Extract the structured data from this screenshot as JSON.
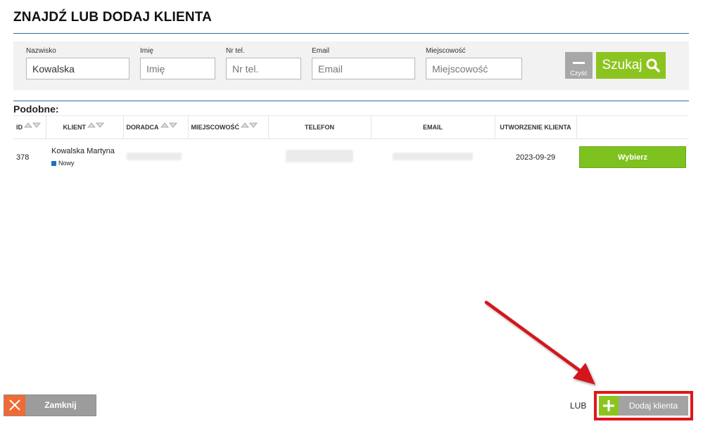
{
  "page": {
    "title": "ZNAJDŹ LUB DODAJ KLIENTA",
    "similar_heading": "Podobne:"
  },
  "search": {
    "fields": [
      {
        "label": "Nazwisko",
        "value": "Kowalska",
        "placeholder": "Nazwisko"
      },
      {
        "label": "Imię",
        "value": "",
        "placeholder": "Imię"
      },
      {
        "label": "Nr tel.",
        "value": "",
        "placeholder": "Nr tel."
      },
      {
        "label": "Email",
        "value": "",
        "placeholder": "Email"
      },
      {
        "label": "Miejscowość",
        "value": "",
        "placeholder": "Miejscowość"
      }
    ],
    "clear_label": "Czyść",
    "search_label": "Szukaj"
  },
  "table": {
    "columns": [
      {
        "label": "ID",
        "sortable": true
      },
      {
        "label": "KLIENT",
        "sortable": true
      },
      {
        "label": "DORADCA",
        "sortable": true
      },
      {
        "label": "MIEJSCOWOŚĆ",
        "sortable": true
      },
      {
        "label": "TELEFON",
        "sortable": false
      },
      {
        "label": "EMAIL",
        "sortable": false
      },
      {
        "label": "UTWORZENIE KLIENTA",
        "sortable": false
      },
      {
        "label": "",
        "sortable": false
      }
    ],
    "rows": [
      {
        "id": "378",
        "client": "Kowalska Martyna",
        "status": "Nowy",
        "city": "",
        "created": "2023-09-29",
        "action": "Wybierz"
      }
    ]
  },
  "footer": {
    "close_label": "Zamknij",
    "or_label": "LUB",
    "add_label": "Dodaj klienta"
  },
  "colors": {
    "accent_blue": "#2e6da4",
    "green": "#8cc41f",
    "orange": "#f06a35",
    "highlight_red": "#e0161b",
    "status_blue": "#1a73c8"
  },
  "icons": {
    "search": "magnifier",
    "clear": "minus",
    "close": "x",
    "add": "plus",
    "sort": "triangle-up-down"
  }
}
